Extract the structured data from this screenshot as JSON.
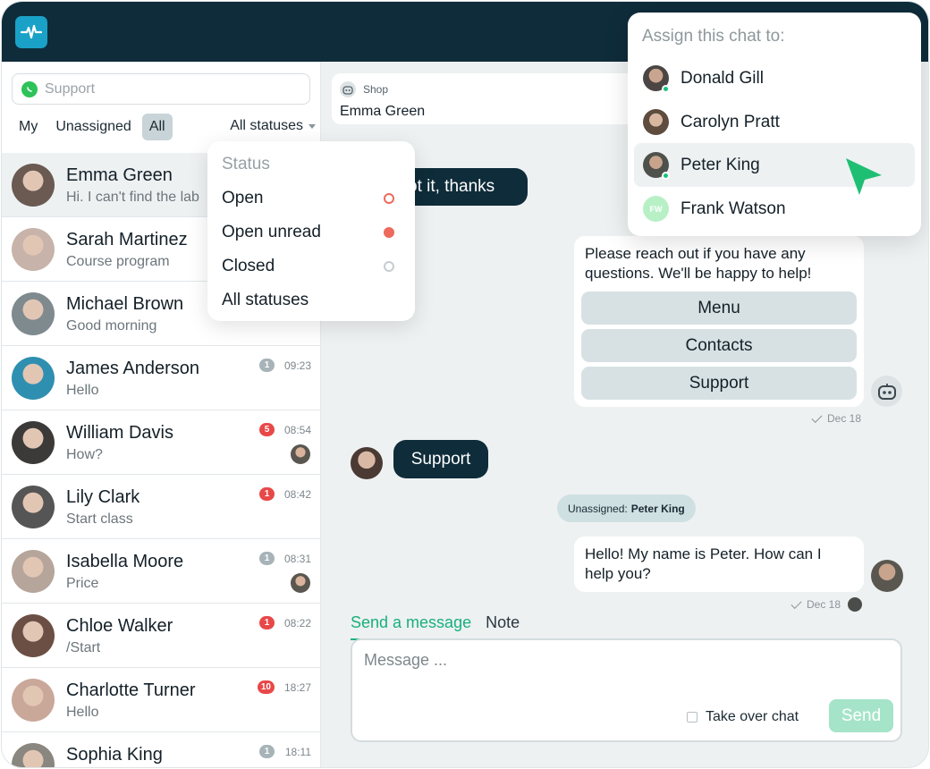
{
  "app": {
    "colors": {
      "topbar": "#0f2c3a",
      "accent": "#18b07a",
      "logo": "#1aa1c7",
      "danger": "#e84848"
    }
  },
  "sidebar": {
    "search_placeholder": "Support",
    "filters": [
      "My",
      "Unassigned",
      "All"
    ],
    "active_filter": "All",
    "status_select": "All statuses",
    "chats": [
      {
        "name": "Emma Green",
        "preview": "Hi. I can't find the lab",
        "time": "",
        "badge": "",
        "badge_color": "",
        "active": true,
        "avatar_color": "#6a5a52"
      },
      {
        "name": "Sarah Martinez",
        "preview": "Course program",
        "time": "",
        "badge": "",
        "badge_color": "",
        "active": false,
        "avatar_color": "#c7b3a9"
      },
      {
        "name": "Michael Brown",
        "preview": "Good morning",
        "time": "",
        "badge": "",
        "badge_color": "",
        "active": false,
        "avatar_color": "#7f8a8f"
      },
      {
        "name": "James Anderson",
        "preview": "Hello",
        "time": "09:23",
        "badge": "1",
        "badge_color": "grey",
        "active": false,
        "avatar_color": "#2f8fb0"
      },
      {
        "name": "William Davis",
        "preview": "How?",
        "time": "08:54",
        "badge": "5",
        "badge_color": "red",
        "active": false,
        "avatar_color": "#3c3a38",
        "mini": true
      },
      {
        "name": "Lily Clark",
        "preview": "Start class",
        "time": "08:42",
        "badge": "1",
        "badge_color": "red",
        "active": false,
        "avatar_color": "#555"
      },
      {
        "name": "Isabella Moore",
        "preview": "Price",
        "time": "08:31",
        "badge": "1",
        "badge_color": "grey",
        "active": false,
        "avatar_color": "#b6a59a",
        "mini": true
      },
      {
        "name": "Chloe Walker",
        "preview": "/Start",
        "time": "08:22",
        "badge": "1",
        "badge_color": "red",
        "active": false,
        "avatar_color": "#6b4f45"
      },
      {
        "name": "Charlotte Turner",
        "preview": "Hello",
        "time": "18:27",
        "badge": "10",
        "badge_color": "red",
        "active": false,
        "avatar_color": "#c9a89a"
      },
      {
        "name": "Sophia King",
        "preview": "",
        "time": "18:11",
        "badge": "1",
        "badge_color": "grey",
        "active": false,
        "avatar_color": "#8a8680"
      }
    ]
  },
  "status_menu": {
    "title": "Status",
    "options": [
      {
        "label": "Open",
        "dot": "ring-red"
      },
      {
        "label": "Open unread",
        "dot": "solid-red"
      },
      {
        "label": "Closed",
        "dot": "ring-grey"
      },
      {
        "label": "All statuses",
        "dot": ""
      }
    ]
  },
  "chat": {
    "source": "Shop",
    "contact_name": "Emma Green",
    "message_partial": "ot it, thanks",
    "bot_message": "Please reach out if you have any questions. We'll be happy to help!",
    "quick_replies": [
      "Menu",
      "Contacts",
      "Support"
    ],
    "bot_meta": "Dec 18",
    "support_bubble": "Support",
    "system_label": "Unassigned:",
    "system_value": "Peter King",
    "agent_message": "Hello! My name is Peter. How can I help you?",
    "agent_meta": "Dec 18"
  },
  "composer": {
    "tabs": [
      "Send a message",
      "Note"
    ],
    "placeholder": "Message ...",
    "takeover_label": "Take over chat",
    "send_label": "Send"
  },
  "assign_menu": {
    "title": "Assign this chat to:",
    "agents": [
      {
        "name": "Donald Gill",
        "online": true,
        "initials": ""
      },
      {
        "name": "Carolyn Pratt",
        "online": false,
        "initials": ""
      },
      {
        "name": "Peter King",
        "online": true,
        "initials": "",
        "hover": true
      },
      {
        "name": "Frank Watson",
        "online": false,
        "initials": "FW"
      }
    ]
  }
}
